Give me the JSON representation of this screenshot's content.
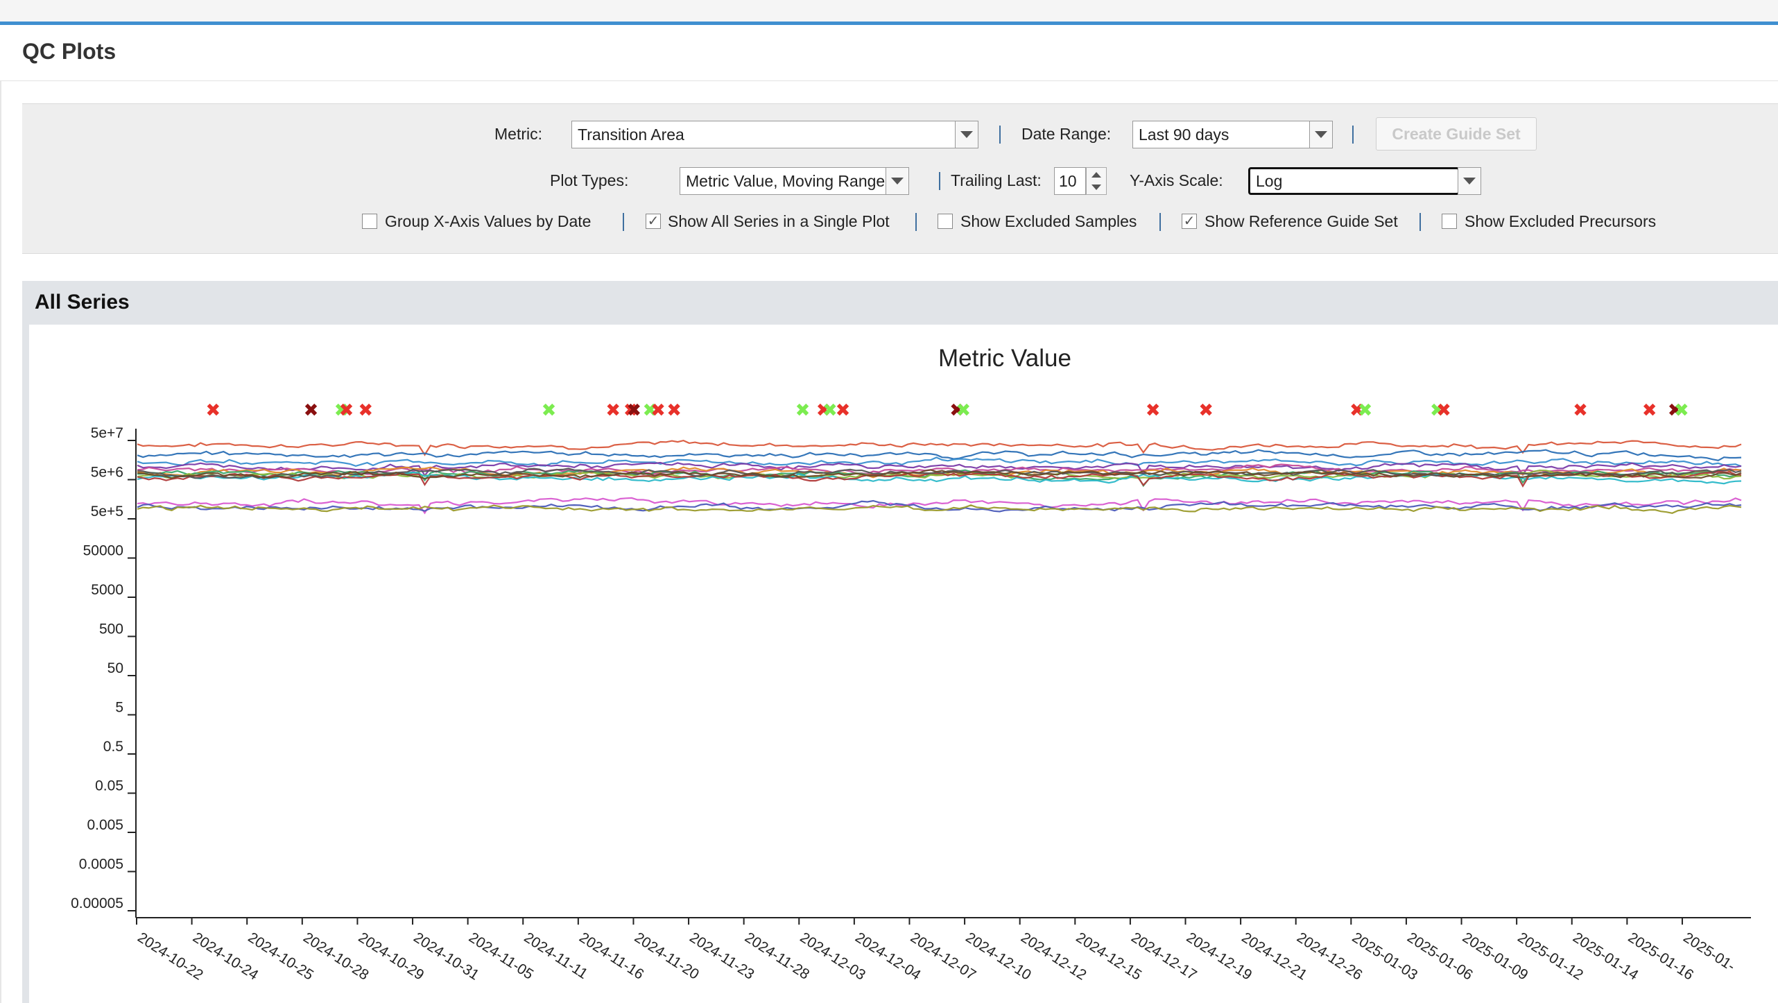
{
  "page": {
    "title": "QC Plots"
  },
  "toolbar": {
    "metric_label": "Metric:",
    "metric_value": "Transition Area",
    "date_range_label": "Date Range:",
    "date_range_value": "Last 90 days",
    "create_guide_set": "Create Guide Set",
    "plot_types_label": "Plot Types:",
    "plot_types_value": "Metric Value, Moving Range",
    "trailing_label": "Trailing Last:",
    "trailing_value": "10",
    "yscale_label": "Y-Axis Scale:",
    "yscale_value": "Log",
    "checkboxes": [
      {
        "label": "Group X-Axis Values by Date",
        "checked": false
      },
      {
        "label": "Show All Series in a Single Plot",
        "checked": true
      },
      {
        "label": "Show Excluded Samples",
        "checked": false
      },
      {
        "label": "Show Reference Guide Set",
        "checked": true
      },
      {
        "label": "Show Excluded Precursors",
        "checked": false
      }
    ]
  },
  "series_panel": {
    "title": "All Series"
  },
  "chart_data": {
    "type": "line",
    "title": "Metric Value",
    "yscale": "log",
    "y_ticks": [
      "5e+7",
      "5e+6",
      "5e+5",
      "50000",
      "5000",
      "500",
      "50",
      "5",
      "0.5",
      "0.05",
      "0.005",
      "0.0005",
      "0.00005"
    ],
    "ylim": [
      5e-05,
      50000000
    ],
    "x_ticks": [
      "2024-10-22",
      "2024-10-24",
      "2024-10-25",
      "2024-10-28",
      "2024-10-29",
      "2024-10-31",
      "2024-11-05",
      "2024-11-11",
      "2024-11-16",
      "2024-11-20",
      "2024-11-23",
      "2024-11-28",
      "2024-12-03",
      "2024-12-04",
      "2024-12-07",
      "2024-12-10",
      "2024-12-12",
      "2024-12-15",
      "2024-12-17",
      "2024-12-19",
      "2024-12-21",
      "2024-12-26",
      "2025-01-03",
      "2025-01-06",
      "2025-01-09",
      "2025-01-12",
      "2025-01-14",
      "2025-01-16",
      "2025-01-"
    ],
    "series_colors": [
      "#d9573b",
      "#2a6fb5",
      "#3a8fd0",
      "#7a3aa8",
      "#c44a9a",
      "#e08a2a",
      "#3aa86a",
      "#8cb83a",
      "#2ab8c8",
      "#b03a3a",
      "#555555",
      "#6a4a2a",
      "#d85ad0",
      "#4a5ab8",
      "#9a9a2a"
    ],
    "series_levels": [
      40000000,
      22000000,
      14000000,
      11000000,
      9000000,
      8000000,
      7000000,
      6500000,
      5500000,
      6000000,
      7500000,
      6800000,
      1300000,
      1000000,
      900000
    ],
    "points_per_series": 280,
    "markers": [
      {
        "pos": 0.048,
        "color": "#e8312a"
      },
      {
        "pos": 0.109,
        "color": "#8a1010"
      },
      {
        "pos": 0.128,
        "color": "#7cec50"
      },
      {
        "pos": 0.131,
        "color": "#e8312a"
      },
      {
        "pos": 0.143,
        "color": "#e8312a"
      },
      {
        "pos": 0.257,
        "color": "#7cec50"
      },
      {
        "pos": 0.297,
        "color": "#e8312a"
      },
      {
        "pos": 0.308,
        "color": "#e8312a"
      },
      {
        "pos": 0.31,
        "color": "#8a1010"
      },
      {
        "pos": 0.32,
        "color": "#7cec50"
      },
      {
        "pos": 0.325,
        "color": "#e8312a"
      },
      {
        "pos": 0.335,
        "color": "#e8312a"
      },
      {
        "pos": 0.415,
        "color": "#7cec50"
      },
      {
        "pos": 0.428,
        "color": "#e8312a"
      },
      {
        "pos": 0.432,
        "color": "#7cec50"
      },
      {
        "pos": 0.44,
        "color": "#e8312a"
      },
      {
        "pos": 0.511,
        "color": "#8a1010"
      },
      {
        "pos": 0.515,
        "color": "#7cec50"
      },
      {
        "pos": 0.633,
        "color": "#e8312a"
      },
      {
        "pos": 0.666,
        "color": "#e8312a"
      },
      {
        "pos": 0.76,
        "color": "#e8312a"
      },
      {
        "pos": 0.765,
        "color": "#7cec50"
      },
      {
        "pos": 0.81,
        "color": "#7cec50"
      },
      {
        "pos": 0.814,
        "color": "#e8312a"
      },
      {
        "pos": 0.899,
        "color": "#e8312a"
      },
      {
        "pos": 0.942,
        "color": "#e8312a"
      },
      {
        "pos": 0.958,
        "color": "#8a1010"
      },
      {
        "pos": 0.962,
        "color": "#7cec50"
      }
    ]
  }
}
